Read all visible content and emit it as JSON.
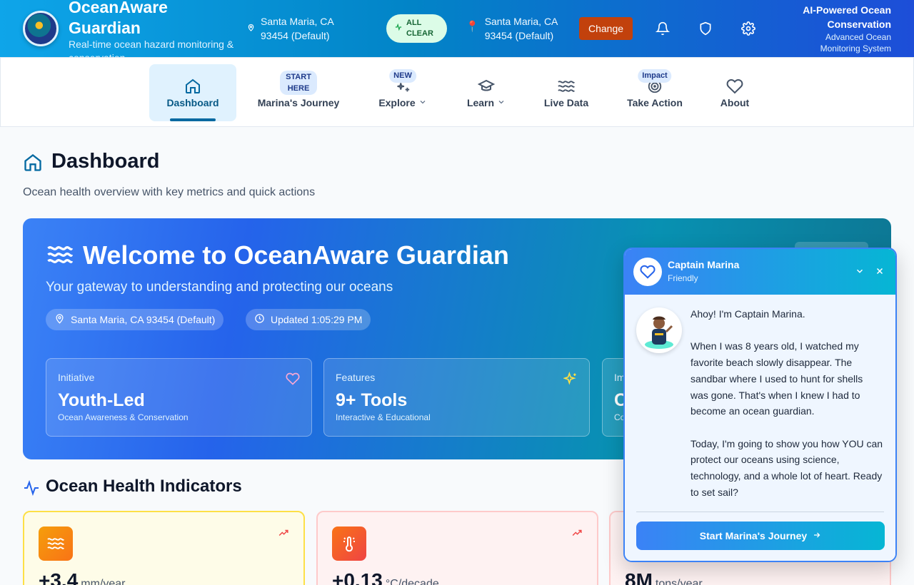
{
  "header": {
    "brand_title": "OceanAware Guardian",
    "brand_subtitle": "Real-time ocean hazard monitoring & conservation",
    "location_primary": "Santa Maria, CA 93454 (Default)",
    "status_label": "ALL CLEAR",
    "location_secondary": "Santa Maria, CA 93454 (Default)",
    "change_label": "Change",
    "ai_title": "AI-Powered Ocean Conservation",
    "ai_subtitle": "Advanced Ocean Monitoring System"
  },
  "nav": {
    "items": [
      {
        "label": "Dashboard",
        "icon": "home-icon",
        "active": true
      },
      {
        "label": "Marina's Journey",
        "badge": "START HERE"
      },
      {
        "label": "Explore",
        "badge": "NEW",
        "icon": "sparkle-plus-icon"
      },
      {
        "label": "Learn",
        "icon": "graduation-cap-icon"
      },
      {
        "label": "Live Data",
        "icon": "waves-icon"
      },
      {
        "label": "Take Action",
        "badge": "Impact",
        "icon": "target-icon"
      },
      {
        "label": "About",
        "icon": "heart-icon"
      }
    ]
  },
  "page": {
    "title": "Dashboard",
    "subtitle": "Ocean health overview with key metrics and quick actions"
  },
  "hero": {
    "title": "Welcome to OceanAware Guardian",
    "subtitle": "Your gateway to understanding and protecting our oceans",
    "location_chip": "Santa Maria, CA 93454 (Default)",
    "updated_chip": "Updated 1:05:29 PM",
    "stats": [
      {
        "label": "Initiative",
        "value": "Youth-Led",
        "desc": "Ocean Awareness & Conservation"
      },
      {
        "label": "Features",
        "value": "9+ Tools",
        "desc": "Interactive & Educational"
      },
      {
        "label": "Im",
        "value": "C",
        "desc": "Co"
      }
    ]
  },
  "indicators": {
    "title": "Ocean Health Indicators",
    "cards": [
      {
        "value": "+3.4",
        "unit": "mm/year"
      },
      {
        "value": "+0.13",
        "unit": "°C/decade"
      },
      {
        "value": "8M",
        "unit": "tons/year"
      }
    ]
  },
  "chat": {
    "name": "Captain Marina",
    "mood": "Friendly",
    "message": "Ahoy! I'm Captain Marina.\n\nWhen I was 8 years old, I watched my favorite beach slowly disappear. The sandbar where I used to hunt for shells was gone. That's when I knew I had to become an ocean guardian.\n\nToday, I'm going to show you how YOU can protect our oceans using science, technology, and a whole lot of heart. Ready to set sail?",
    "cta": "Start Marina's Journey"
  },
  "colors": {
    "accent": "#0284c7",
    "status_ok": "#dcfce7",
    "change_button": "#c2410c"
  }
}
